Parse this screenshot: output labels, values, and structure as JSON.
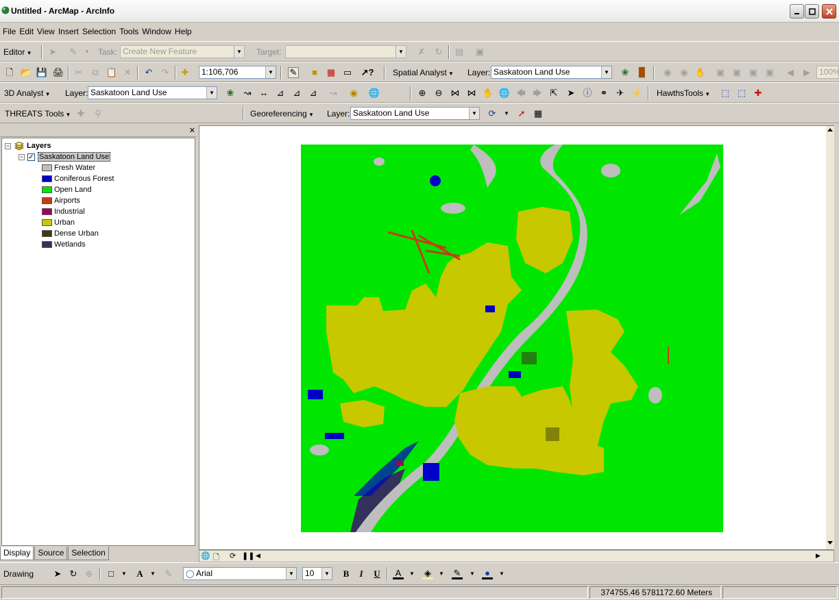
{
  "window": {
    "title": "Untitled - ArcMap - ArcInfo"
  },
  "menu": [
    "File",
    "Edit",
    "View",
    "Insert",
    "Selection",
    "Tools",
    "Window",
    "Help"
  ],
  "editor_toolbar": {
    "editor_label": "Editor",
    "task_label": "Task:",
    "task_value": "Create New Feature",
    "target_label": "Target:",
    "target_value": ""
  },
  "standard_toolbar": {
    "scale": "1:106,706",
    "spatial_analyst_label": "Spatial Analyst",
    "layer_label": "Layer:",
    "layer_value": "Saskatoon Land Use",
    "zoom_value": "100%"
  },
  "analyst_toolbar": {
    "analyst_label": "3D Analyst",
    "layer_label": "Layer:",
    "layer_value": "Saskatoon Land Use",
    "hawths_label": "HawthsTools"
  },
  "threats_toolbar": {
    "threats_label": "THREATS Tools",
    "georef_label": "Georeferencing",
    "layer_label": "Layer:",
    "layer_value": "Saskatoon Land Use"
  },
  "toc": {
    "root": "Layers",
    "layer": "Saskatoon Land Use",
    "legend": [
      {
        "label": "Fresh Water",
        "color": "#bebebe"
      },
      {
        "label": "Coniferous Forest",
        "color": "#0000c8"
      },
      {
        "label": "Open Land",
        "color": "#00e600"
      },
      {
        "label": "Airports",
        "color": "#c83c14"
      },
      {
        "label": "Industrial",
        "color": "#a0005a"
      },
      {
        "label": "Urban",
        "color": "#c8c800"
      },
      {
        "label": "Dense Urban",
        "color": "#3c3c14"
      },
      {
        "label": "Wetlands",
        "color": "#32325a"
      }
    ],
    "tabs": [
      "Display",
      "Source",
      "Selection"
    ]
  },
  "drawing_toolbar": {
    "drawing_label": "Drawing",
    "font_name": "Arial",
    "font_size": "10",
    "bold": "B",
    "italic": "I",
    "underline": "U",
    "text_button": "A"
  },
  "status": {
    "coordinates": "374755.46  5781172.60 Meters"
  }
}
